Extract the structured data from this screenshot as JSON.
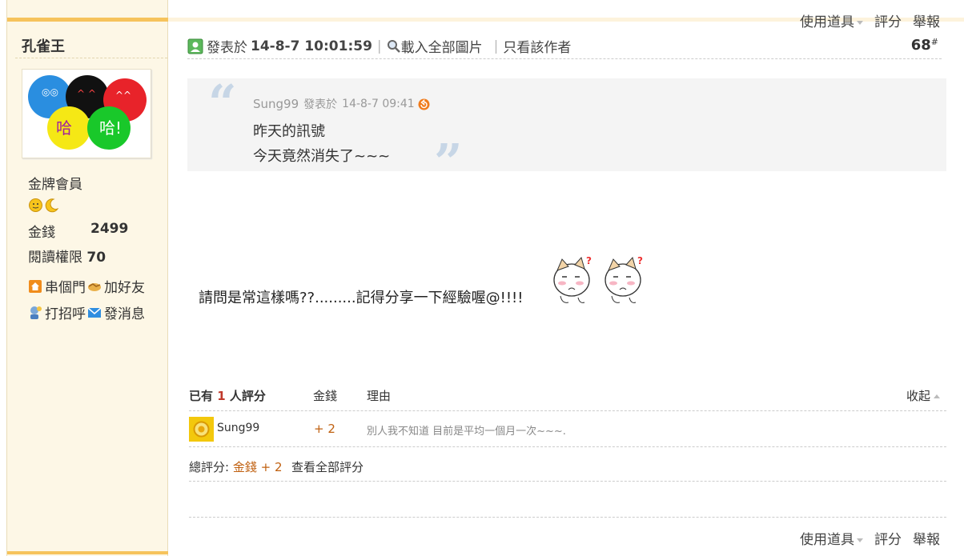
{
  "author": {
    "name": "孔雀王",
    "rank": "金牌會員",
    "stats": [
      {
        "label": "金錢",
        "value": "2499"
      },
      {
        "label": "閱讀權限",
        "value": "70"
      }
    ],
    "actions": [
      {
        "label": "串個門",
        "icon": "home-icon"
      },
      {
        "label": "加好友",
        "icon": "handshake-icon"
      },
      {
        "label": "打招呼",
        "icon": "greet-icon"
      },
      {
        "label": "發消息",
        "icon": "mail-icon"
      }
    ]
  },
  "toolbar": {
    "use_item": "使用道具",
    "rate": "評分",
    "report": "舉報"
  },
  "post": {
    "posted_prefix": "發表於",
    "posted_date": "14-8-7 10:01:59",
    "load_images": "載入全部圖片",
    "only_author": "只看該作者",
    "floor_number": "68",
    "floor_mark": "#"
  },
  "quote": {
    "author": "Sung99",
    "prefix": "發表於",
    "date": "14-8-7 09:41",
    "lines": [
      "昨天的訊號",
      "今天竟然消失了~~~"
    ]
  },
  "message": "請問是常這樣嗎??.........記得分享一下經驗喔@!!!!",
  "rating": {
    "header_prefix": "已有",
    "count": "1",
    "header_suffix": "人評分",
    "col_money": "金錢",
    "col_reason": "理由",
    "collapse": "收起",
    "rows": [
      {
        "user": "Sung99",
        "money": "+ 2",
        "reason": "別人我不知道 目前是平均一個月一次~~~."
      }
    ],
    "total_label": "總評分:",
    "total_money_label": "金錢",
    "total_money_value": "+ 2",
    "view_all": "查看全部評分"
  },
  "colors": {
    "sidebar_bg": "#fdf7e6",
    "accent_bar": "#f6c35c",
    "quote_bg": "#f4f4f4",
    "rating_count": "#c0392b",
    "money": "#c06010"
  }
}
